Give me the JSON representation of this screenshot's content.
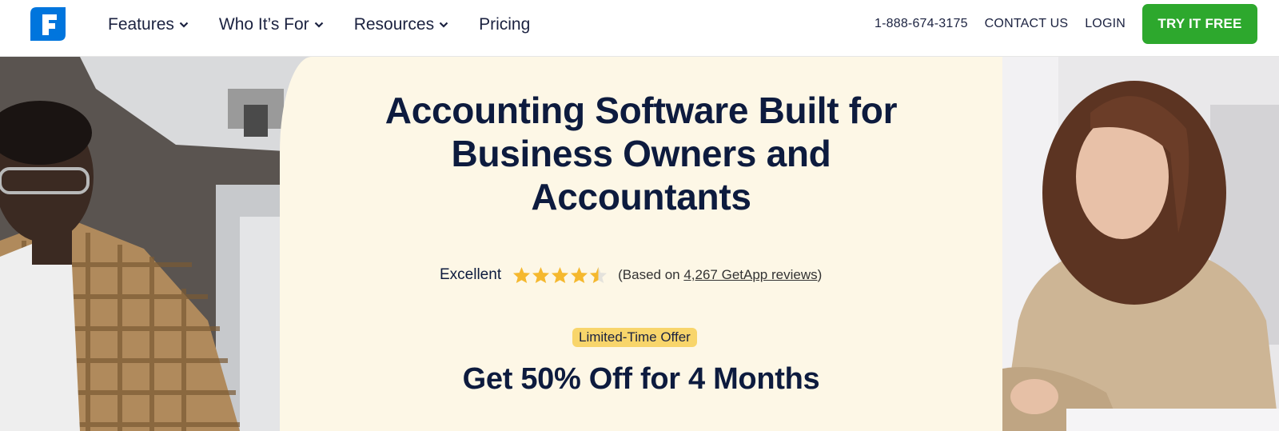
{
  "header": {
    "logo_letter": "F",
    "nav": [
      {
        "label": "Features",
        "has_dropdown": true
      },
      {
        "label": "Who It’s For",
        "has_dropdown": true
      },
      {
        "label": "Resources",
        "has_dropdown": true
      },
      {
        "label": "Pricing",
        "has_dropdown": false
      }
    ],
    "phone": "1-888-674-3175",
    "contact": "CONTACT US",
    "login": "LOGIN",
    "cta": "TRY IT FREE"
  },
  "hero": {
    "title": "Accounting Software Built for Business Owners and Accountants",
    "rating": {
      "label": "Excellent",
      "stars": 4.5,
      "based_prefix": "(Based on ",
      "reviews_link": "4,267 GetApp reviews",
      "based_suffix": ")"
    },
    "offer_badge": "Limited-Time Offer",
    "offer_title": "Get 50% Off for 4 Months"
  },
  "colors": {
    "brand_blue": "#0075dd",
    "cta_green": "#2da82d",
    "cream": "#fdf7e6",
    "navy": "#0d1b3e",
    "star": "#f5b82e",
    "badge": "#f8d56b"
  }
}
